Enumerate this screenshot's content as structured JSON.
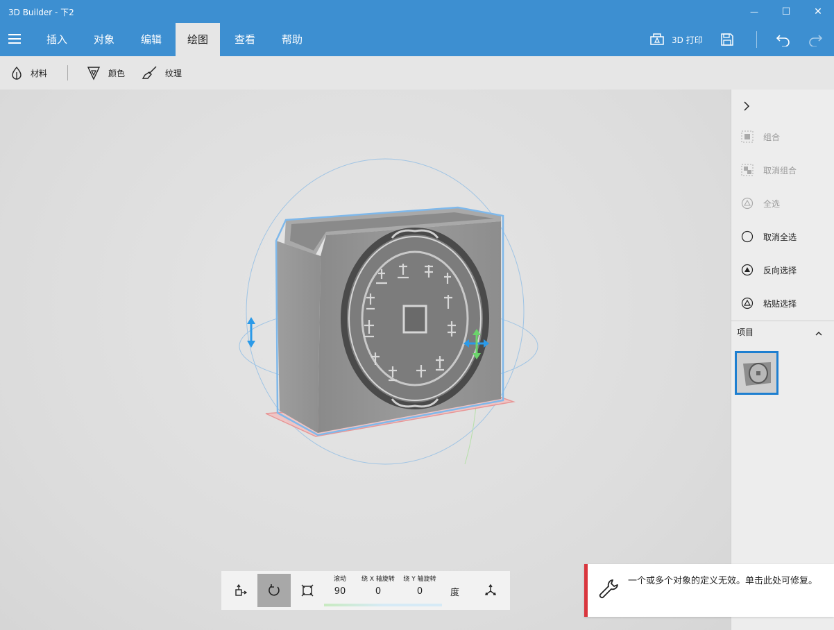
{
  "window": {
    "title": "3D Builder - 下2",
    "minimize_glyph": "—",
    "maximize_glyph": "☐",
    "close_glyph": "✕"
  },
  "ribbon": {
    "tabs": [
      {
        "label": "插入"
      },
      {
        "label": "对象"
      },
      {
        "label": "编辑"
      },
      {
        "label": "绘图",
        "active": true
      },
      {
        "label": "查看"
      },
      {
        "label": "帮助"
      }
    ],
    "print_label": "3D 打印",
    "icons": [
      "menu-icon",
      "printer-3d-icon",
      "save-icon",
      "undo-icon",
      "redo-icon"
    ]
  },
  "subbar": {
    "material_label": "材料",
    "color_label": "颜色",
    "texture_label": "纹理",
    "icons": [
      "material-icon",
      "color-fill-icon",
      "texture-brush-icon"
    ]
  },
  "right_panel": {
    "items": [
      {
        "label": "组合",
        "enabled": false
      },
      {
        "label": "取消组合",
        "enabled": false
      },
      {
        "label": "全选",
        "enabled": false
      },
      {
        "label": "取消全选",
        "enabled": true
      },
      {
        "label": "反向选择",
        "enabled": true
      },
      {
        "label": "粘贴选择",
        "enabled": true
      }
    ],
    "items_header": "项目"
  },
  "transform_bar": {
    "roll_label": "滚动",
    "roll_value": "90",
    "x_label": "绕 X 轴旋转",
    "x_value": "0",
    "y_label": "绕 Y 轴旋转",
    "y_value": "0",
    "unit": "度"
  },
  "notification": {
    "message": "一个或多个对象的定义无效。单击此处可修复。"
  },
  "colors": {
    "accent": "#3d8fd1",
    "selection": "#1e7fd0",
    "error": "#d9363e"
  }
}
